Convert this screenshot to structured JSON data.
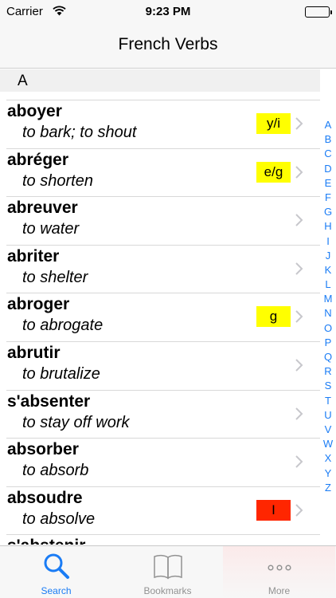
{
  "status_bar": {
    "carrier": "Carrier",
    "time": "9:23 PM",
    "battery_level": 1.0
  },
  "nav": {
    "title": "French Verbs"
  },
  "section": {
    "letter": "A"
  },
  "verbs": [
    {
      "verb": "aboyer",
      "translation": "to bark; to shout",
      "badge": "y/i",
      "badge_color": "#ffff00"
    },
    {
      "verb": "abréger",
      "translation": "to shorten",
      "badge": "e/g",
      "badge_color": "#ffff00"
    },
    {
      "verb": "abreuver",
      "translation": "to water",
      "badge": "",
      "badge_color": ""
    },
    {
      "verb": "abriter",
      "translation": "to shelter",
      "badge": "",
      "badge_color": ""
    },
    {
      "verb": "abroger",
      "translation": "to abrogate",
      "badge": "g",
      "badge_color": "#ffff00"
    },
    {
      "verb": "abrutir",
      "translation": "to brutalize",
      "badge": "",
      "badge_color": ""
    },
    {
      "verb": "s'absenter",
      "translation": "to stay off work",
      "badge": "",
      "badge_color": ""
    },
    {
      "verb": "absorber",
      "translation": "to absorb",
      "badge": "",
      "badge_color": ""
    },
    {
      "verb": "absoudre",
      "translation": "to absolve",
      "badge": "I",
      "badge_color": "#ff2600"
    },
    {
      "verb": "s'abstenir",
      "translation": "",
      "badge": "",
      "badge_color": ""
    }
  ],
  "index_letters": [
    "A",
    "B",
    "C",
    "D",
    "E",
    "F",
    "G",
    "H",
    "I",
    "J",
    "K",
    "L",
    "M",
    "N",
    "O",
    "P",
    "Q",
    "R",
    "S",
    "T",
    "U",
    "V",
    "W",
    "X",
    "Y",
    "Z"
  ],
  "tabs": [
    {
      "label": "Search",
      "icon": "search-icon",
      "selected": true
    },
    {
      "label": "Bookmarks",
      "icon": "book-icon",
      "selected": false
    },
    {
      "label": "More",
      "icon": "more-icon",
      "selected": false
    }
  ],
  "colors": {
    "accent": "#1a7cf5",
    "inactive": "#929292",
    "badge_yellow": "#ffff00",
    "badge_red": "#ff2600"
  }
}
